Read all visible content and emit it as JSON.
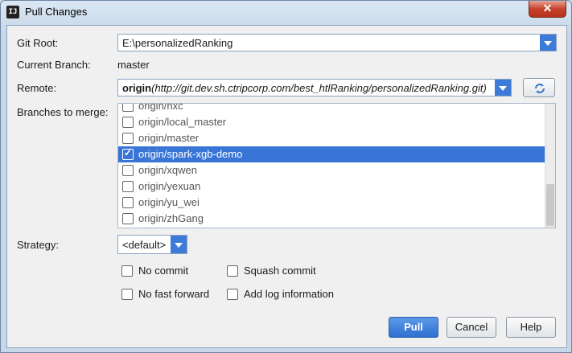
{
  "window": {
    "title": "Pull Changes",
    "close_symbol": "✕"
  },
  "app_icon_text": "IJ",
  "git_root": {
    "label": "Git Root:",
    "value": "E:\\personalizedRanking"
  },
  "current_branch": {
    "label": "Current Branch:",
    "value": "master"
  },
  "remote": {
    "label": "Remote:",
    "name": "origin",
    "url": "(http://git.dev.sh.ctripcorp.com/best_htlRanking/personalizedRanking.git)"
  },
  "branches": {
    "label": "Branches to merge:",
    "items": [
      {
        "label": "origin/hxc",
        "checked": false,
        "selected": false
      },
      {
        "label": "origin/local_master",
        "checked": false,
        "selected": false
      },
      {
        "label": "origin/master",
        "checked": false,
        "selected": false
      },
      {
        "label": "origin/spark-xgb-demo",
        "checked": true,
        "selected": true
      },
      {
        "label": "origin/xqwen",
        "checked": false,
        "selected": false
      },
      {
        "label": "origin/yexuan",
        "checked": false,
        "selected": false
      },
      {
        "label": "origin/yu_wei",
        "checked": false,
        "selected": false
      },
      {
        "label": "origin/zhGang",
        "checked": false,
        "selected": false
      }
    ]
  },
  "strategy": {
    "label": "Strategy:",
    "value": "<default>"
  },
  "options": {
    "no_commit": "No commit",
    "squash_commit": "Squash commit",
    "no_fast_forward": "No fast forward",
    "add_log_information": "Add log information"
  },
  "buttons": {
    "pull": "Pull",
    "cancel": "Cancel",
    "help": "Help"
  }
}
